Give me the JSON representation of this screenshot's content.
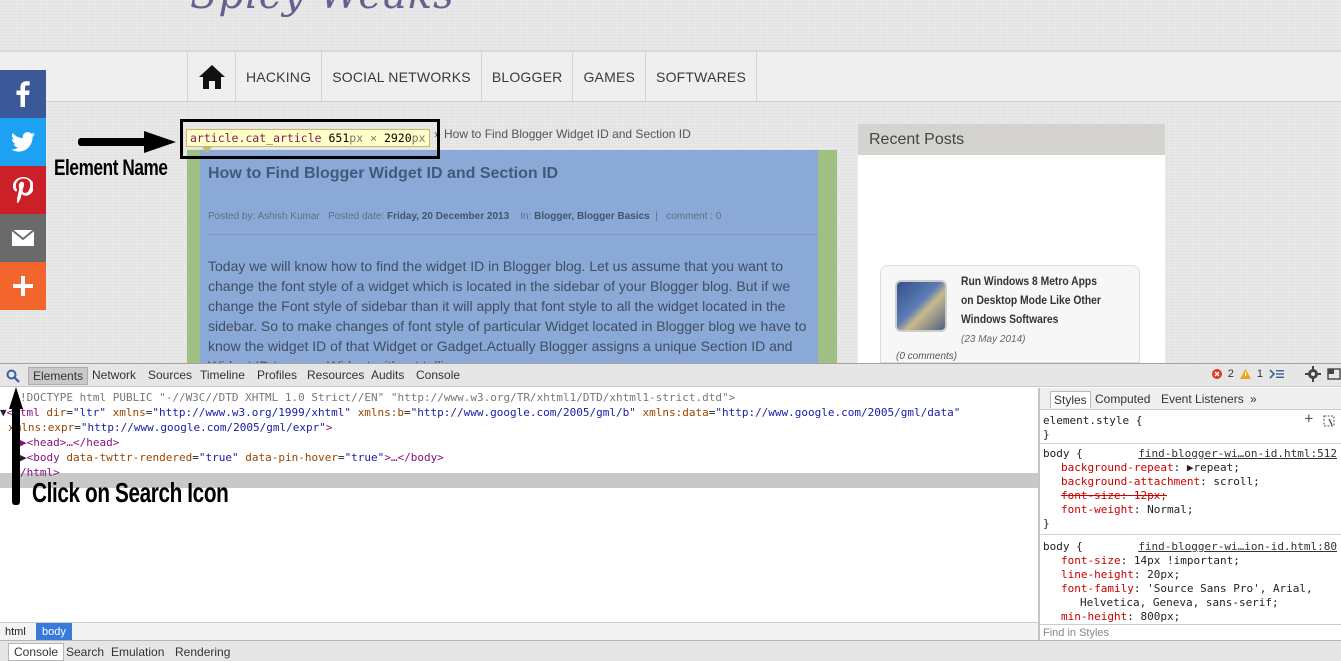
{
  "blog": {
    "logo_text": "Spicy Weaks",
    "nav": [
      "HACKING",
      "SOCIAL NETWORKS",
      "BLOGGER",
      "GAMES",
      "SOFTWARES"
    ],
    "social": [
      {
        "icon": "facebook-icon",
        "color": "#3b5998"
      },
      {
        "icon": "twitter-icon",
        "color": "#1da1f2"
      },
      {
        "icon": "pinterest-icon",
        "color": "#cb2027"
      },
      {
        "icon": "email-icon",
        "color": "#6a6a6a"
      },
      {
        "icon": "more-icon",
        "color": "#f2662d"
      }
    ],
    "breadcrumb": "» How to Find Blogger Widget ID and Section ID",
    "post": {
      "title": "How to Find Blogger Widget ID and Section ID",
      "meta_by": "Posted by: Ashish Kumar",
      "meta_date_label": "Posted date:",
      "meta_date": "Friday, 20 December 2013",
      "meta_in_label": "In:",
      "meta_in": "Blogger, Blogger Basics",
      "meta_comment": "comment : 0",
      "body": "Today we will know how to find the widget ID in Blogger blog. Let us assume that you want to change the font style of a widget which is located in the sidebar of your Blogger blog. But if we change the Font style of sidebar than it will apply that font style to all the widget located in the sidebar. So to make changes of font style of particular Widget located in Blogger blog we have to know the widget ID of that Widget or Gadget.Actually Blogger assigns a unique Section ID and Widget ID to every Widget without telling"
    },
    "tooltip": {
      "selector": "article.cat_article",
      "width": "651",
      "height": "2920",
      "unit": "px",
      "times": "×"
    },
    "sidebar": {
      "heading": "Recent Posts",
      "recent_title": "Run Windows 8 Metro Apps on Desktop Mode Like Other Windows Softwares",
      "recent_date": "(23 May 2014)",
      "recent_comments": "(0 comments)"
    }
  },
  "annotations": {
    "element_name": "Element Name",
    "click_search": "Click on Search Icon"
  },
  "devtools": {
    "tabs": [
      "Elements",
      "Network",
      "Sources",
      "Timeline",
      "Profiles",
      "Resources",
      "Audits",
      "Console"
    ],
    "errors": "2",
    "warnings": "1",
    "dom": {
      "doctype": "!DOCTYPE html PUBLIC \"-//W3C//DTD XHTML 1.0 Strict//EN\" \"http://www.w3.org/TR/xhtml1/DTD/xhtml1-strict.dtd\">",
      "html_open": "html",
      "html_attrs": [
        {
          "name": "dir",
          "value": "\"ltr\""
        },
        {
          "name": "xmlns",
          "value": "\"http://www.w3.org/1999/xhtml\""
        },
        {
          "name": "xmlns:b",
          "value": "\"http://www.google.com/2005/gml/b\""
        },
        {
          "name": "xmlns:data",
          "value": "\"http://www.google.com/2005/gml/data\""
        }
      ],
      "html_attr_cont_name": "xmlns:expr",
      "html_attr_cont_value": "\"http://www.google.com/2005/gml/expr\"",
      "head": "<head>…</head>",
      "body_tag": "body",
      "body_attr1_name": "data-twttr-rendered",
      "body_attr1_value": "\"true\"",
      "body_attr2_name": "data-pin-hover",
      "body_attr2_value": "\"true\"",
      "body_close": ">…</body>",
      "html_close": "/html>"
    },
    "breadcrumbs": [
      "html",
      "body"
    ],
    "styles_tabs": [
      "Styles",
      "Computed",
      "Event Listeners",
      "»"
    ],
    "styles": {
      "element_style": "element.style {",
      "close": "}",
      "rule1_selector": "body {",
      "rule1_link": "find-blogger-wi…on-id.html:512",
      "rule1_props": [
        {
          "name": "background-repeat",
          "value": "▶repeat;",
          "strike": false
        },
        {
          "name": "background-attachment",
          "value": "scroll;",
          "strike": false
        },
        {
          "name": "font-size",
          "value": "12px;",
          "strike": true
        },
        {
          "name": "font-weight",
          "value": "Normal;",
          "strike": false
        }
      ],
      "rule2_selector": "body {",
      "rule2_link": "find-blogger-wi…ion-id.html:80",
      "rule2_props": [
        {
          "name": "font-size",
          "value": "14px !important;"
        },
        {
          "name": "line-height",
          "value": "20px;"
        },
        {
          "name": "font-family",
          "value": "'Source Sans Pro', Arial,"
        },
        {
          "name": "",
          "value": "Helvetica, Geneva, sans-serif;"
        },
        {
          "name": "min-height",
          "value": "800px;"
        }
      ]
    },
    "find_in_styles": "Find in Styles",
    "drawer_tabs": [
      "Console",
      "Search",
      "Emulation",
      "Rendering"
    ]
  }
}
